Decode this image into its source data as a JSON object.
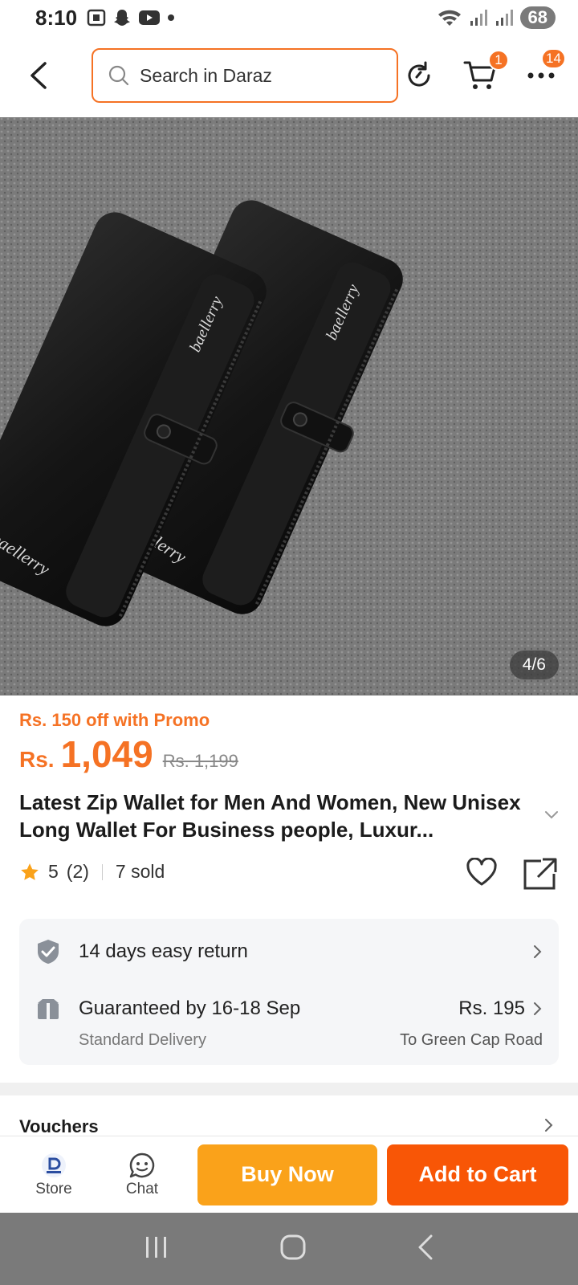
{
  "status_bar": {
    "time": "8:10",
    "battery": "68"
  },
  "search": {
    "placeholder": "Search in Daraz"
  },
  "badges": {
    "cart": "1",
    "more": "14"
  },
  "gallery": {
    "counter": "4/6",
    "brand_marks": [
      "baellerry",
      "baellerry",
      "baellerry",
      "baellerry"
    ]
  },
  "product": {
    "promo": "Rs. 150 off with Promo",
    "currency": "Rs.",
    "price": "1,049",
    "original_price": "Rs. 1,199",
    "title": "Latest Zip Wallet for Men And Women, New Unisex Long Wallet For Business people, Luxur...",
    "rating": "5",
    "reviews": "(2)",
    "sold": "7 sold"
  },
  "services": {
    "return_text": "14 days easy return",
    "delivery_text": "Guaranteed by 16-18 Sep",
    "delivery_price": "Rs. 195",
    "delivery_type": "Standard Delivery",
    "delivery_location": "To Green Cap Road"
  },
  "vouchers": {
    "label": "Vouchers"
  },
  "bottom_bar": {
    "store_label": "Store",
    "chat_label": "Chat",
    "buy_now": "Buy Now",
    "add_to_cart": "Add to Cart"
  },
  "colors": {
    "accent": "#f57224",
    "buy_now": "#faa21a",
    "add_to_cart": "#f85606"
  }
}
